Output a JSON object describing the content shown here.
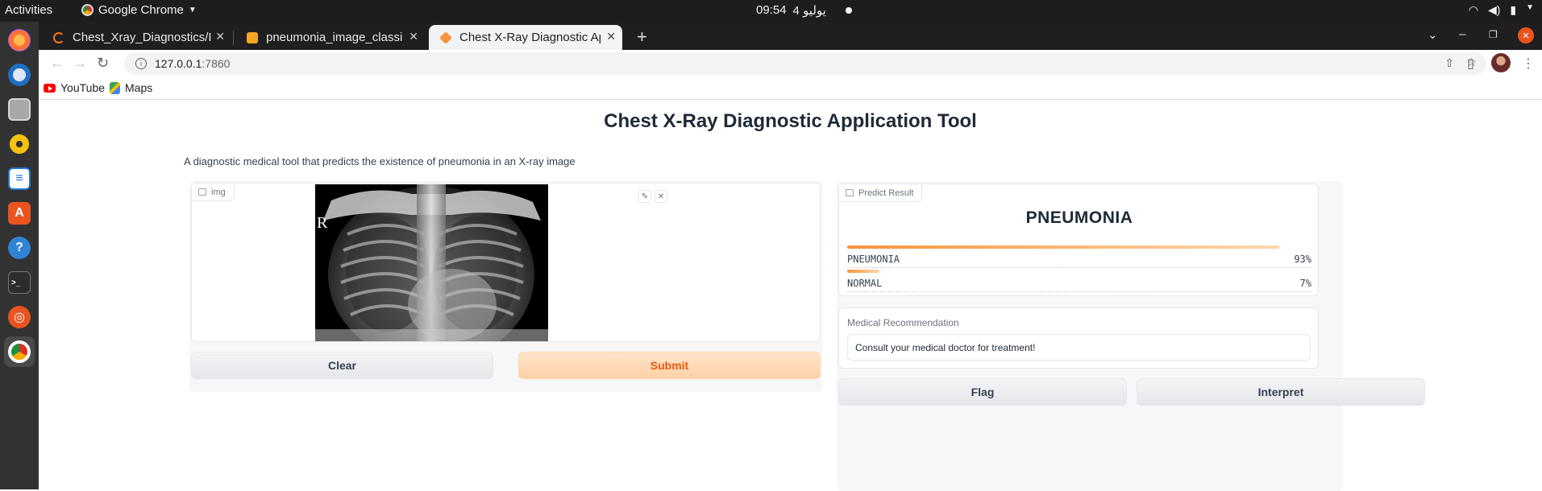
{
  "topbar": {
    "activities": "Activities",
    "app_name": "Google Chrome",
    "clock_time": "09:54",
    "clock_date": "4 يوليو"
  },
  "dock": {
    "items": [
      "firefox-icon",
      "thunderbird-icon",
      "files-icon",
      "rhythmbox-icon",
      "writer-icon",
      "software-icon",
      "help-icon",
      "terminal-icon",
      "ubuntu-icon",
      "chrome-icon"
    ]
  },
  "tabs": [
    {
      "title": "Chest_Xray_Diagnostics/I",
      "active": false
    },
    {
      "title": "pneumonia_image_classi",
      "active": false
    },
    {
      "title": "Chest X-Ray Diagnostic Ap",
      "active": true
    }
  ],
  "address": {
    "host": "127.0.0.1",
    "port": ":7860"
  },
  "bookmarks": [
    {
      "label": "YouTube"
    },
    {
      "label": "Maps"
    }
  ],
  "app": {
    "title": "Chest X-Ray Diagnostic Application Tool",
    "description": "A diagnostic medical tool that predicts the existence of pneumonia in an X-ray image",
    "input_label": "img",
    "xray_marker": "R",
    "clear_label": "Clear",
    "submit_label": "Submit",
    "result_chip": "Predict Result",
    "predicted_label": "PNEUMONIA",
    "confidences": [
      {
        "label": "PNEUMONIA",
        "percent": "93%",
        "value": 0.93
      },
      {
        "label": "NORMAL",
        "percent": "7%",
        "value": 0.07
      }
    ],
    "recommendation_label": "Medical Recommendation",
    "recommendation_text": "Consult your medical doctor for treatment!",
    "flag_label": "Flag",
    "interpret_label": "Interpret"
  },
  "colors": {
    "accent": "#fb923c",
    "primary_text": "#ea580c"
  }
}
